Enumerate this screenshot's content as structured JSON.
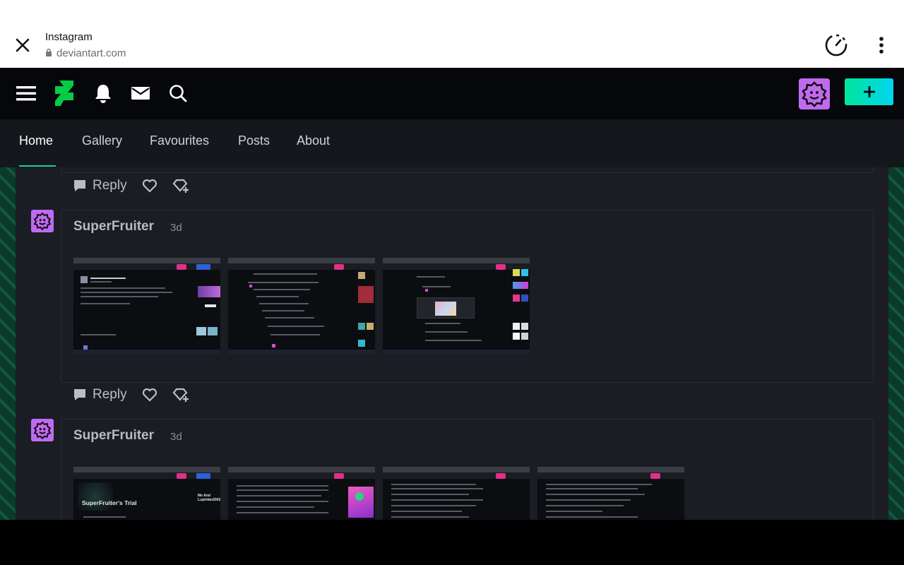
{
  "browser": {
    "title": "Instagram",
    "url": "deviantart.com"
  },
  "nav": {
    "brand_color": "#05cc47",
    "create_gradient": [
      "#00e59b",
      "#00d6f0"
    ],
    "avatar_color": "#c06af2"
  },
  "tabs": [
    {
      "label": "Home",
      "active": true
    },
    {
      "label": "Gallery",
      "active": false
    },
    {
      "label": "Favourites",
      "active": false
    },
    {
      "label": "Posts",
      "active": false
    },
    {
      "label": "About",
      "active": false
    }
  ],
  "actions": {
    "reply_label": "Reply"
  },
  "comments": [
    {
      "user": "SuperFruiter",
      "time": "3d",
      "image_count": 3
    },
    {
      "user": "SuperFruiter",
      "time": "3d",
      "image_count": 4
    }
  ],
  "thumbnails": {
    "c2_t1_title": "SuperFruiter's Trial",
    "c2_t2_title": "Me And Lupinfan2002"
  }
}
